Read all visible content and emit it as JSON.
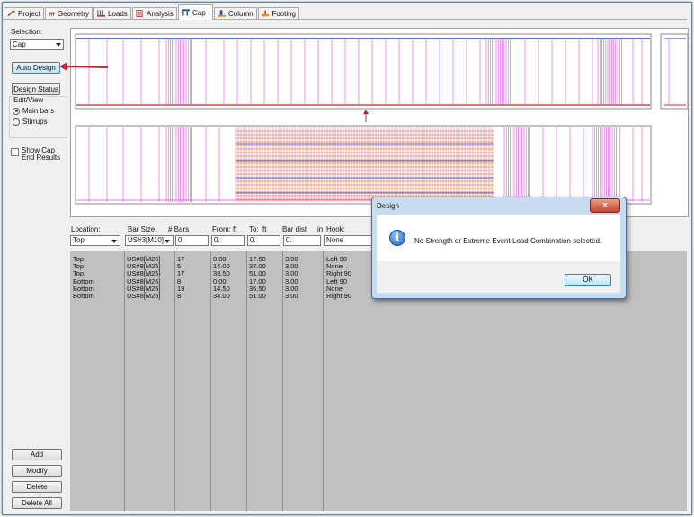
{
  "tabs": [
    {
      "label": "Project",
      "icon": "project-icon"
    },
    {
      "label": "Geometry",
      "icon": "geometry-icon"
    },
    {
      "label": "Loads",
      "icon": "loads-icon"
    },
    {
      "label": "Analysis",
      "icon": "analysis-icon"
    },
    {
      "label": "Cap",
      "icon": "cap-icon",
      "active": true
    },
    {
      "label": "Column",
      "icon": "column-icon"
    },
    {
      "label": "Footing",
      "icon": "footing-icon"
    }
  ],
  "sidebar": {
    "selection_label": "Selection:",
    "selection_value": "Cap",
    "auto_design": "Auto Design",
    "design_status": "Design Status",
    "edit_view_label": "Edit/View",
    "main_bars": "Main bars",
    "stirrups": "Stirrups",
    "show_cap_end": "Show Cap End Results",
    "add": "Add",
    "modify": "Modify",
    "delete": "Delete",
    "delete_all": "Delete All"
  },
  "editor": {
    "headers": {
      "location": "Location:",
      "bar_size": "Bar Size:",
      "num_bars": "# Bars",
      "from": "From:",
      "from_unit": "ft",
      "to": "To:",
      "to_unit": "ft",
      "bar_dist": "Bar dist",
      "bar_dist_unit": "in",
      "hook": "Hook:"
    },
    "inputs": {
      "location": "Top",
      "bar_size": "US#3[M10]",
      "num_bars": "0",
      "from": "0.",
      "to": "0.",
      "bar_dist": "0.",
      "hook": "None"
    }
  },
  "bars_table": {
    "rows": [
      [
        "Top",
        "US#8[M25]",
        "17",
        "0.00",
        "17.50",
        "3.00",
        "Left 90"
      ],
      [
        "Top",
        "US#8[M25]",
        "5",
        "14.00",
        "37.00",
        "3.00",
        "None"
      ],
      [
        "Top",
        "US#8[M25]",
        "17",
        "33.50",
        "51.00",
        "3.00",
        "Right 90"
      ],
      [
        "Bottom",
        "US#8[M25]",
        "8",
        "0.00",
        "17.00",
        "3.00",
        "Left 90"
      ],
      [
        "Bottom",
        "US#8[M25]",
        "19",
        "14.50",
        "36.50",
        "3.00",
        "None"
      ],
      [
        "Bottom",
        "US#8[M25]",
        "8",
        "34.00",
        "51.00",
        "3.00",
        "Right 90"
      ]
    ]
  },
  "dialog": {
    "title": "Design",
    "close": "x",
    "message": "No Strength or Extreme Event Load Combination selected.",
    "ok": "OK"
  },
  "colors": {
    "annotation_arrow": "#c0272d",
    "rebar_magenta": "#d84fd8",
    "stirrup_orange": "#f0a040",
    "cap_blue": "#2f3fc0",
    "grid_bg": "#c0c0c0"
  }
}
